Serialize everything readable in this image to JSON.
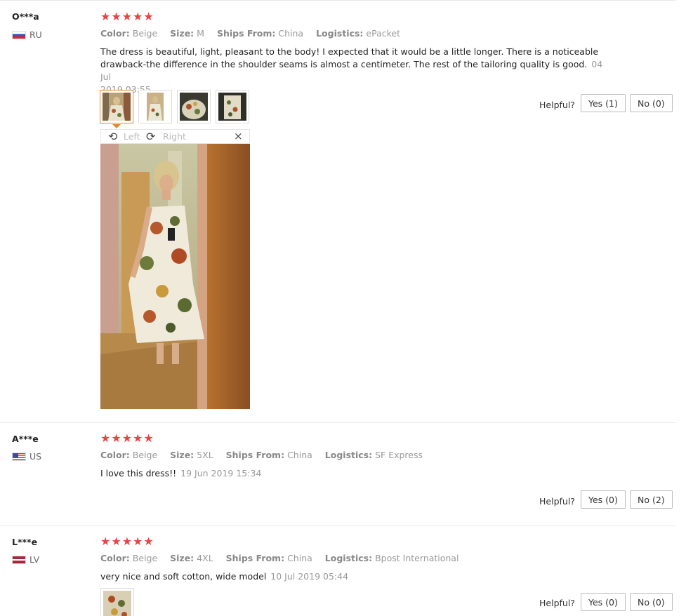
{
  "labels": {
    "color": "Color:",
    "size": "Size:",
    "ships_from": "Ships From:",
    "logistics": "Logistics:",
    "helpful": "Helpful?"
  },
  "reviews": [
    {
      "user": "O***a",
      "country": "RU",
      "stars": "★★★★★",
      "rating": 5,
      "color": "Beige",
      "size": "M",
      "ships_from": "China",
      "logistics": "ePacket",
      "text_line1": "The dress is beautiful, light, pleasant to the body! I expected that it would be a little longer. There is a noticeable",
      "text_line2": "drawback-the difference in the shoulder seams is almost a centimeter. The rest of the tailoring quality is good.",
      "date_part1": "04 Jul",
      "date_part2": "2019 03:55",
      "yes": "Yes (1)",
      "no": "No (0)",
      "viewer": {
        "left": "Left",
        "right": "Right",
        "close": "×"
      }
    },
    {
      "user": "A***e",
      "country": "US",
      "stars": "★★★★★",
      "rating": 5,
      "color": "Beige",
      "size": "5XL",
      "ships_from": "China",
      "logistics": "SF Express",
      "text": "I love this dress!!",
      "date": "19 Jun 2019 15:34",
      "yes": "Yes (0)",
      "no": "No (2)"
    },
    {
      "user": "L***e",
      "country": "LV",
      "stars": "★★★★★",
      "rating": 5,
      "color": "Beige",
      "size": "4XL",
      "ships_from": "China",
      "logistics": "Bpost International",
      "text": "very nice and soft cotton, wide model",
      "date": "10 Jul 2019 05:44",
      "yes": "Yes (0)",
      "no": "No (0)"
    }
  ],
  "colors": {
    "star": "#e64545",
    "active_thumb": "#e08a2a",
    "muted": "#999999"
  }
}
